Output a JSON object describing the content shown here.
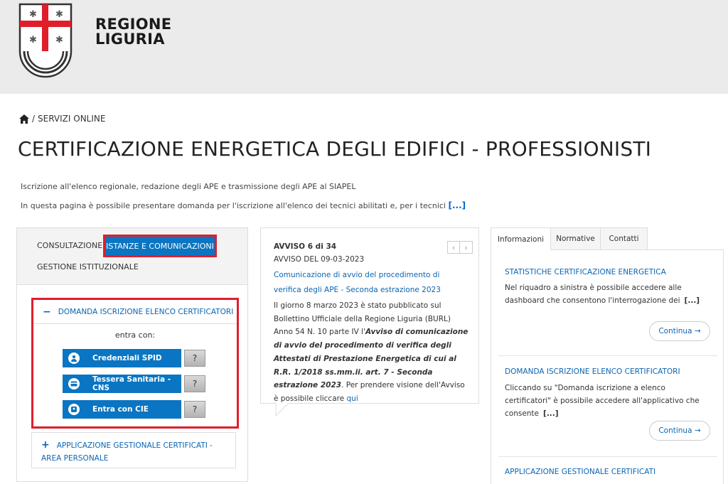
{
  "header": {
    "logo_line1": "REGIONE",
    "logo_line2": "LIGURIA"
  },
  "breadcrumb": {
    "home_icon": "home-icon",
    "separator": "/",
    "current": "SERVIZI ONLINE"
  },
  "page_title": "CERTIFICAZIONE ENERGETICA DEGLI EDIFICI - PROFESSIONISTI",
  "intro": {
    "line1": "Iscrizione all'elenco regionale, redazione degli APE e trasmissione degli APE al SIAPEL",
    "line2": "In questa pagina è possibile presentare domanda per l'iscrizione all'elenco dei tecnici abilitati e, per i tecnici",
    "more": "[...]"
  },
  "left_panel": {
    "tabs": {
      "consultazione": "CONSULTAZIONE",
      "istanze": "ISTANZE E COMUNICAZIONI",
      "gestione": "GESTIONE ISTITUZIONALE"
    },
    "accordion1": {
      "sign": "−",
      "title": "DOMANDA ISCRIZIONE ELENCO CERTIFICATORI",
      "subtitle": "entra con:",
      "logins": [
        {
          "label": "Credenziali SPID",
          "icon": "user-icon",
          "help": "?"
        },
        {
          "label": "Tessera Sanitaria - CNS",
          "icon": "card-icon",
          "help": "?"
        },
        {
          "label": "Entra con CIE",
          "icon": "id-card-icon",
          "help": "?"
        }
      ]
    },
    "accordion2": {
      "sign": "+",
      "title": "APPLICAZIONE GESTIONALE CERTIFICATI - AREA PERSONALE"
    }
  },
  "news": {
    "count": "AVVISO 6 di 34",
    "date": "AVVISO DEL 09-03-2023",
    "nav_prev": "‹",
    "nav_next": "›",
    "title": "Comunicazione di avvio del procedimento di verifica degli APE - Seconda estrazione 2023",
    "body_start": "Il giorno 8 marzo 2023 è stato pubblicato sul Bollettino Ufficiale della Regione Liguria (BURL) Anno 54 N. 10 parte IV l'",
    "body_italic": "Avviso di comunicazione di avvio del procedimento di verifica degli Attestati di Prestazione Energetica di cui al R.R. 1/2018 ss.mm.ii. art. 7 - Seconda estrazione 2023",
    "body_end": ". Per prendere visione dell'Avviso è possibile cliccare ",
    "body_link": "qui"
  },
  "right_panel": {
    "tabs": {
      "informazioni": "Informazioni",
      "normative": "Normative",
      "contatti": "Contatti"
    },
    "sections": [
      {
        "title": "STATISTICHE CERTIFICAZIONE ENERGETICA",
        "text": "Nel riquadro a sinistra è possibile accedere alle dashboard che consentono l'interrogazione dei",
        "more": "[...]",
        "button": "Continua →"
      },
      {
        "title": "DOMANDA ISCRIZIONE ELENCO CERTIFICATORI",
        "text": "Cliccando su \"Domanda iscrizione a elenco certificatori\" è possibile accedere all'applicativo che consente",
        "more": "[...]",
        "button": "Continua →"
      },
      {
        "title": "APPLICAZIONE GESTIONALE CERTIFICATI"
      }
    ]
  },
  "colors": {
    "brand_blue": "#0a75c2",
    "link_blue": "#0a65b4",
    "highlight_red": "#e01e2b",
    "header_bg": "#ebebeb"
  }
}
